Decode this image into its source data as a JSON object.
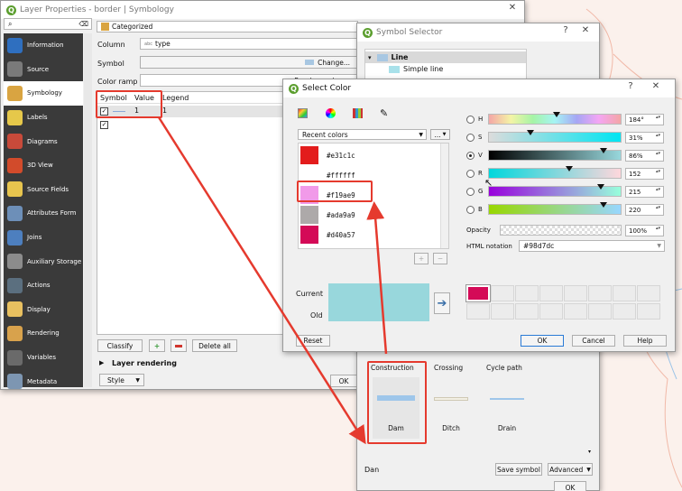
{
  "layer_props": {
    "title": "Layer Properties - border | Symbology",
    "sidebar": [
      {
        "label": "Information",
        "icon": "info-icon",
        "color": "#2f6fbf"
      },
      {
        "label": "Source",
        "icon": "source-icon",
        "color": "#7a7a7a"
      },
      {
        "label": "Symbology",
        "icon": "brush-icon",
        "color": "#d9a441"
      },
      {
        "label": "Labels",
        "icon": "labels-icon",
        "color": "#e6c84a"
      },
      {
        "label": "Diagrams",
        "icon": "diagram-icon",
        "color": "#c84a3a"
      },
      {
        "label": "3D View",
        "icon": "cube-icon",
        "color": "#d24b2b"
      },
      {
        "label": "Source Fields",
        "icon": "fields-icon",
        "color": "#e7c44e"
      },
      {
        "label": "Attributes Form",
        "icon": "form-icon",
        "color": "#6d8fb8"
      },
      {
        "label": "Joins",
        "icon": "joins-icon",
        "color": "#4d7fbf"
      },
      {
        "label": "Auxiliary Storage",
        "icon": "storage-icon",
        "color": "#8c8c8c"
      },
      {
        "label": "Actions",
        "icon": "gear-icon",
        "color": "#5b6f7f"
      },
      {
        "label": "Display",
        "icon": "display-icon",
        "color": "#e8c060"
      },
      {
        "label": "Rendering",
        "icon": "rendering-icon",
        "color": "#d8a24c"
      },
      {
        "label": "Variables",
        "icon": "variables-icon",
        "color": "#6a6a6a"
      },
      {
        "label": "Metadata",
        "icon": "metadata-icon",
        "color": "#7d96b2"
      }
    ],
    "renderer": "Categorized",
    "column_label": "Column",
    "column_value": "type",
    "column_prefix": "abc",
    "symbol_label": "Symbol",
    "change_label": "Change...",
    "ramp_label": "Color ramp",
    "ramp_value": "Random colors",
    "table_headers": [
      "Symbol",
      "Value",
      "Legend"
    ],
    "rows": [
      {
        "value": "1",
        "legend": "1"
      },
      {
        "value": "",
        "legend": ""
      }
    ],
    "classify": "Classify",
    "delete_all": "Delete all",
    "layer_rendering": "Layer rendering",
    "style": "Style",
    "ok": "OK"
  },
  "symbol_selector": {
    "title": "Symbol Selector",
    "tree_root": "Line",
    "tree_child": "Simple line",
    "categories": [
      "Construction",
      "Crossing",
      "Cycle path"
    ],
    "symbols": [
      "Dam",
      "Ditch",
      "Drain"
    ],
    "name_field": "Dan",
    "save_symbol": "Save symbol",
    "advanced": "Advanced",
    "ok": "OK"
  },
  "select_color": {
    "title": "Select Color",
    "recent_label": "Recent colors",
    "recent_menu": "...",
    "swatches": [
      {
        "hex": "#e31c1c",
        "label": "#e31c1c"
      },
      {
        "hex": "#ffffff",
        "label": "#ffffff"
      },
      {
        "hex": "#f19ae9",
        "label": "#f19ae9"
      },
      {
        "hex": "#ada9a9",
        "label": "#ada9a9"
      },
      {
        "hex": "#d40a57",
        "label": "#d40a57"
      }
    ],
    "channels": [
      {
        "label": "H",
        "value": "184°",
        "checked": false,
        "pos": 0.51
      },
      {
        "label": "S",
        "value": "31%",
        "checked": false,
        "pos": 0.31
      },
      {
        "label": "V",
        "value": "86%",
        "checked": true,
        "pos": 0.86
      },
      {
        "label": "R",
        "value": "152",
        "checked": false,
        "pos": 0.6
      },
      {
        "label": "G",
        "value": "215",
        "checked": false,
        "pos": 0.84
      },
      {
        "label": "B",
        "value": "220",
        "checked": false,
        "pos": 0.86
      }
    ],
    "opacity_label": "Opacity",
    "opacity_value": "100%",
    "html_label": "HTML notation",
    "html_value": "#98d7dc",
    "current_label": "Current",
    "old_label": "Old",
    "current_color": "#98d7dc",
    "custom_first": "#d40a57",
    "reset": "Reset",
    "ok": "OK",
    "cancel": "Cancel",
    "help": "Help"
  },
  "colors": {
    "annotation_red": "#e53a2e",
    "qgis_green": "#5b9e2e"
  }
}
